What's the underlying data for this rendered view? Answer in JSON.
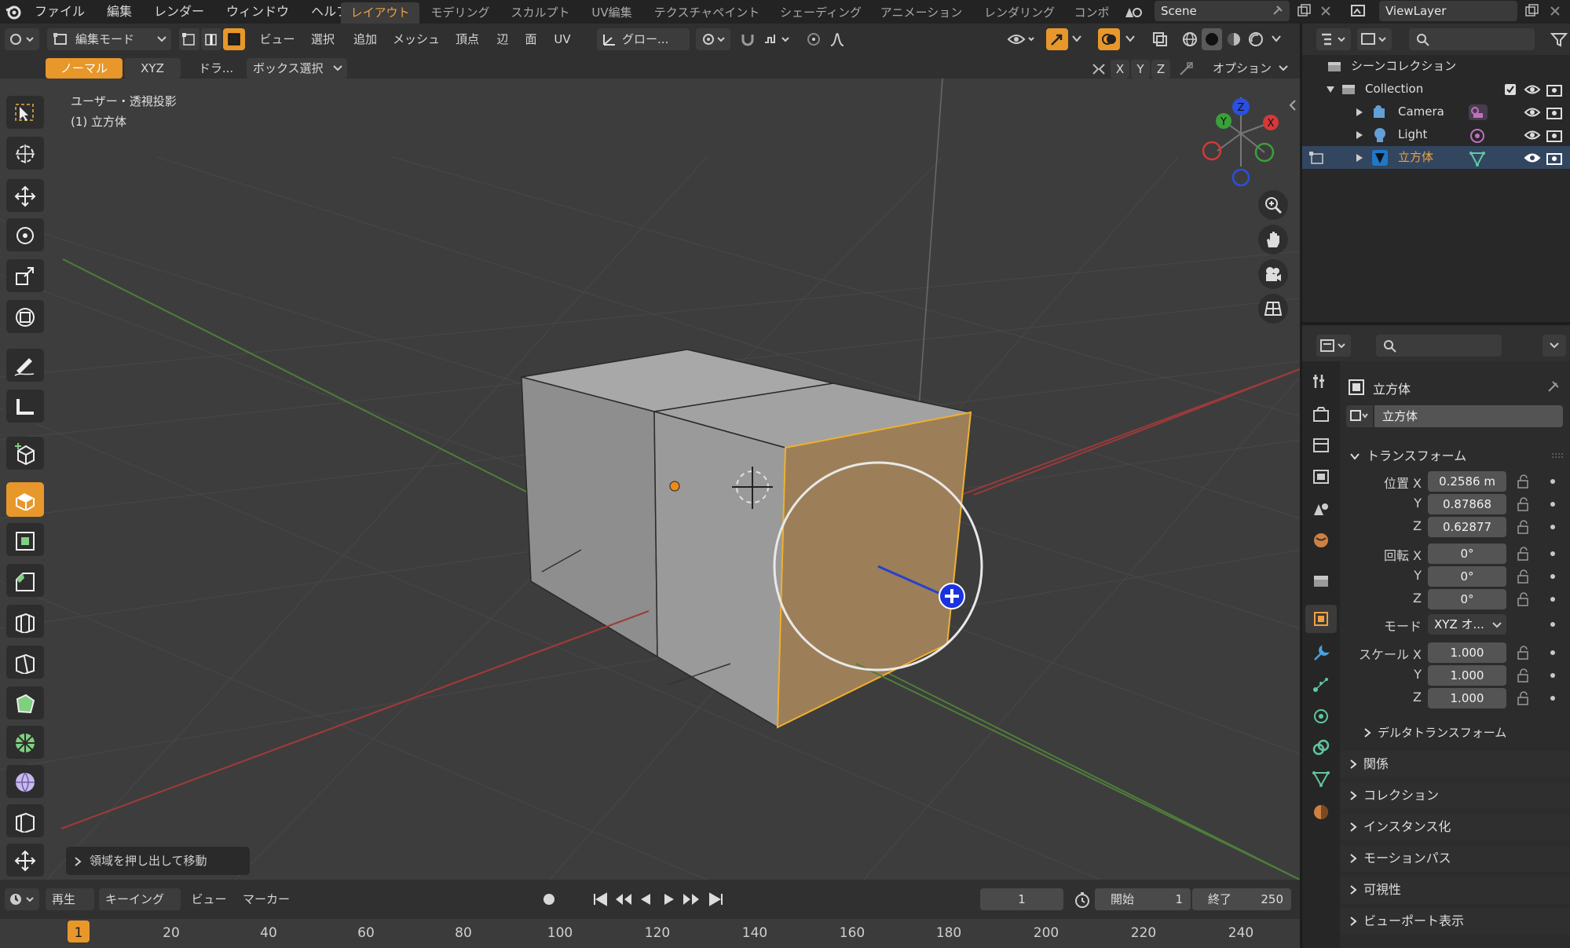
{
  "topbar": {
    "menus": [
      "ファイル",
      "編集",
      "レンダー",
      "ウィンドウ",
      "ヘルプ"
    ],
    "workspaces": [
      "レイアウト",
      "モデリング",
      "スカルプト",
      "UV編集",
      "テクスチャペイント",
      "シェーディング",
      "アニメーション",
      "レンダリング",
      "コンポ"
    ],
    "active_workspace": "レイアウト",
    "scene": "Scene",
    "view_layer": "ViewLayer"
  },
  "header": {
    "mode": "編集モード",
    "menus": [
      "ビュー",
      "選択",
      "追加",
      "メッシュ",
      "頂点",
      "辺",
      "面",
      "UV"
    ],
    "transform_orientation": "グロー...",
    "row2_normal": "ノーマル",
    "row2_xyz": "XYZ",
    "row2_drag": "ドラ...",
    "row2_select": "ボックス選択",
    "axis_x": "X",
    "axis_y": "Y",
    "axis_z": "Z",
    "options": "オプション"
  },
  "viewport": {
    "view_name": "ユーザー・透視投影",
    "object_info": "(1) 立方体",
    "operator_panel": "領域を押し出して移動",
    "gizmo_x": "X",
    "gizmo_y": "Y",
    "gizmo_z": "Z"
  },
  "timeline": {
    "menus": [
      "再生",
      "キーイング",
      "ビュー",
      "マーカー"
    ],
    "current_frame": "1",
    "start_label": "開始",
    "start": "1",
    "end_label": "終了",
    "end": "250",
    "ruler": [
      "1",
      "20",
      "40",
      "60",
      "80",
      "100",
      "120",
      "140",
      "160",
      "180",
      "200",
      "220",
      "240"
    ]
  },
  "outliner": {
    "scene_collection": "シーンコレクション",
    "collection": "Collection",
    "items": [
      "Camera",
      "Light",
      "立方体"
    ]
  },
  "properties": {
    "object_name": "立方体",
    "object_field": "立方体",
    "transform_title": "トランスフォーム",
    "location_label": "位置 X",
    "loc_x": "0.2586 m",
    "loc_y": "0.87868",
    "loc_z": "0.62877",
    "rotation_label": "回転 X",
    "rot_x": "0°",
    "rot_y": "0°",
    "rot_z": "0°",
    "mode_label": "モード",
    "mode_value": "XYZ オ...",
    "scale_label": "スケール X",
    "scale_x": "1.000",
    "scale_y": "1.000",
    "scale_z": "1.000",
    "label_y": "Y",
    "label_z": "Z",
    "delta": "デルタトランスフォーム",
    "sections": [
      "関係",
      "コレクション",
      "インスタンス化",
      "モーションパス",
      "可視性",
      "ビューポート表示"
    ]
  },
  "colors": {
    "accent": "#e8972a",
    "selection_blue": "#334660",
    "face_selected": "#9c7f58"
  }
}
